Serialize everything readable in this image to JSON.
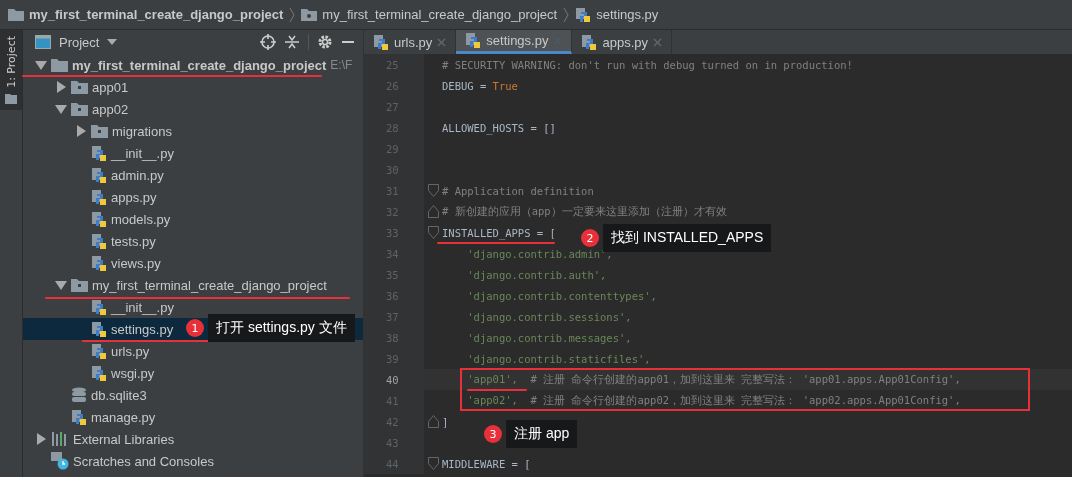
{
  "breadcrumbs": [
    {
      "label": "my_first_terminal_create_django_project",
      "kind": "project"
    },
    {
      "label": "my_first_terminal_create_django_project",
      "kind": "folder"
    },
    {
      "label": "settings.py",
      "kind": "file"
    }
  ],
  "tool_strip": {
    "label": "1: Project",
    "selected": true
  },
  "panel": {
    "title": "Project"
  },
  "tree": [
    {
      "name": "my_first_terminal_create_django_project",
      "suffix": "E:\\F",
      "kind": "folder",
      "expanded": true,
      "selected": false,
      "children": [
        {
          "name": "app01",
          "kind": "module",
          "expanded": false,
          "selected": false
        },
        {
          "name": "app02",
          "kind": "module",
          "expanded": true,
          "selected": false,
          "children": [
            {
              "name": "migrations",
              "kind": "module",
              "expanded": false,
              "selected": false
            },
            {
              "name": "__init__.py",
              "kind": "python",
              "selected": false
            },
            {
              "name": "admin.py",
              "kind": "python",
              "selected": false
            },
            {
              "name": "apps.py",
              "kind": "python",
              "selected": false
            },
            {
              "name": "models.py",
              "kind": "python",
              "selected": false
            },
            {
              "name": "tests.py",
              "kind": "python",
              "selected": false
            },
            {
              "name": "views.py",
              "kind": "python",
              "selected": false
            }
          ]
        },
        {
          "name": "my_first_terminal_create_django_project",
          "kind": "module",
          "expanded": true,
          "selected": false,
          "children": [
            {
              "name": "__init__.py",
              "kind": "python",
              "selected": false
            },
            {
              "name": "settings.py",
              "kind": "python",
              "selected": true
            },
            {
              "name": "urls.py",
              "kind": "python",
              "selected": false
            },
            {
              "name": "wsgi.py",
              "kind": "python",
              "selected": false
            }
          ]
        },
        {
          "name": "db.sqlite3",
          "kind": "database",
          "selected": false
        },
        {
          "name": "manage.py",
          "kind": "python",
          "selected": false
        }
      ]
    },
    {
      "name": "External Libraries",
      "kind": "library",
      "expanded": false,
      "selected": false
    },
    {
      "name": "Scratches and Consoles",
      "kind": "scratches",
      "selected": false
    }
  ],
  "tabs": [
    {
      "label": "urls.py",
      "selected": false
    },
    {
      "label": "settings.py",
      "selected": true
    },
    {
      "label": "apps.py",
      "selected": false
    }
  ],
  "code": [
    {
      "number": "25",
      "current": false,
      "kind": "plain",
      "tokens": [
        {
          "text": "# SECURITY WARNING: don't run with debug turned on in production!",
          "kind": "comment"
        }
      ]
    },
    {
      "number": "26",
      "current": false,
      "kind": "plain",
      "tokens": [
        {
          "text": "DEBUG = ",
          "kind": "plain"
        },
        {
          "text": "True",
          "kind": "keyword"
        }
      ]
    },
    {
      "number": "27",
      "current": false,
      "kind": "plain"
    },
    {
      "number": "28",
      "current": false,
      "kind": "plain",
      "tokens": [
        {
          "text": "ALLOWED_HOSTS = []",
          "kind": "plain"
        }
      ]
    },
    {
      "number": "29",
      "current": false,
      "kind": "plain"
    },
    {
      "number": "30",
      "current": false,
      "kind": "plain"
    },
    {
      "number": "31",
      "current": false,
      "kind": "opener",
      "tokens": [
        {
          "text": "# Application definition",
          "kind": "comment"
        }
      ]
    },
    {
      "number": "32",
      "current": false,
      "kind": "closer",
      "tokens": [
        {
          "text": "# 新创建的应用（app）一定要来这里添加（注册）才有效",
          "kind": "comment"
        }
      ]
    },
    {
      "number": "33",
      "current": false,
      "kind": "opener",
      "tokens": [
        {
          "text": "INSTALLED_APPS = [",
          "kind": "plain"
        }
      ]
    },
    {
      "number": "34",
      "current": false,
      "kind": "plain",
      "tokens": [
        {
          "text": "    'django.contrib.admin',",
          "kind": "string"
        }
      ]
    },
    {
      "number": "35",
      "current": false,
      "kind": "plain",
      "tokens": [
        {
          "text": "    'django.contrib.auth',",
          "kind": "string"
        }
      ]
    },
    {
      "number": "36",
      "current": false,
      "kind": "plain",
      "tokens": [
        {
          "text": "    'django.contrib.contenttypes',",
          "kind": "string"
        }
      ]
    },
    {
      "number": "37",
      "current": false,
      "kind": "plain",
      "tokens": [
        {
          "text": "    'django.contrib.sessions',",
          "kind": "string"
        }
      ]
    },
    {
      "number": "38",
      "current": false,
      "kind": "plain",
      "tokens": [
        {
          "text": "    'django.contrib.messages',",
          "kind": "string"
        }
      ]
    },
    {
      "number": "39",
      "current": false,
      "kind": "plain",
      "tokens": [
        {
          "text": "    'django.contrib.staticfiles',",
          "kind": "string"
        }
      ]
    },
    {
      "number": "40",
      "current": true,
      "kind": "plain",
      "tokens": [
        {
          "text": "    'app01',",
          "kind": "string"
        },
        {
          "text": "  # 注册 命令行创建的app01，加到这里来 完整写法： 'app01.apps.App01Config',",
          "kind": "comment"
        }
      ]
    },
    {
      "number": "41",
      "current": false,
      "kind": "plain",
      "tokens": [
        {
          "text": "    'app02',",
          "kind": "string"
        },
        {
          "text": "  # 注册 命令行创建的app02，加到这里来 完整写法： 'app02.apps.App01Config',",
          "kind": "comment"
        }
      ]
    },
    {
      "number": "42",
      "current": false,
      "kind": "closer",
      "tokens": [
        {
          "text": "]",
          "kind": "plain"
        }
      ]
    },
    {
      "number": "43",
      "current": false,
      "kind": "plain"
    },
    {
      "number": "44",
      "current": false,
      "kind": "opener",
      "tokens": [
        {
          "text": "MIDDLEWARE = [",
          "kind": "plain"
        }
      ]
    }
  ],
  "annotations": [
    {
      "number": "1",
      "text": "打开 settings.py 文件"
    },
    {
      "number": "2",
      "text": "找到 INSTALLED_APPS"
    },
    {
      "number": "3",
      "text": "注册 app"
    }
  ]
}
